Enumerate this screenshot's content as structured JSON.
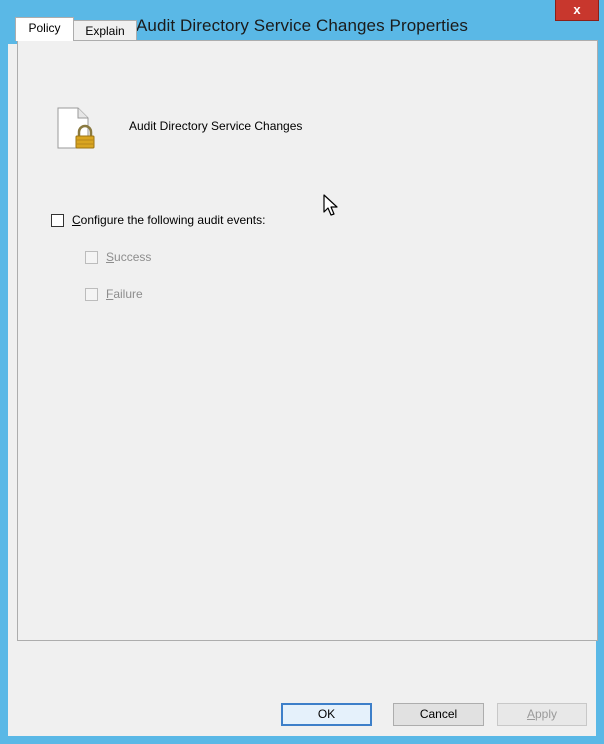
{
  "window": {
    "title": "Audit Directory Service Changes Properties",
    "close_label": "x"
  },
  "tabs": [
    {
      "label": "Policy",
      "selected": true
    },
    {
      "label": "Explain",
      "selected": false
    }
  ],
  "policy": {
    "name": "Audit Directory Service Changes",
    "icon": "locked-document-icon"
  },
  "options": {
    "configure": {
      "label_first": "C",
      "label_rest": "onfigure the following audit events:",
      "checked": false
    },
    "success": {
      "label_first": "S",
      "label_rest": "uccess",
      "checked": false,
      "enabled": false
    },
    "failure": {
      "label_first": "F",
      "label_rest": "ailure",
      "checked": false,
      "enabled": false
    }
  },
  "buttons": {
    "ok": "OK",
    "cancel": "Cancel",
    "apply_first": "A",
    "apply_rest": "pply"
  },
  "colors": {
    "titlebar": "#5ab8e6",
    "close": "#c8372d",
    "panel": "#f0f0f0"
  }
}
